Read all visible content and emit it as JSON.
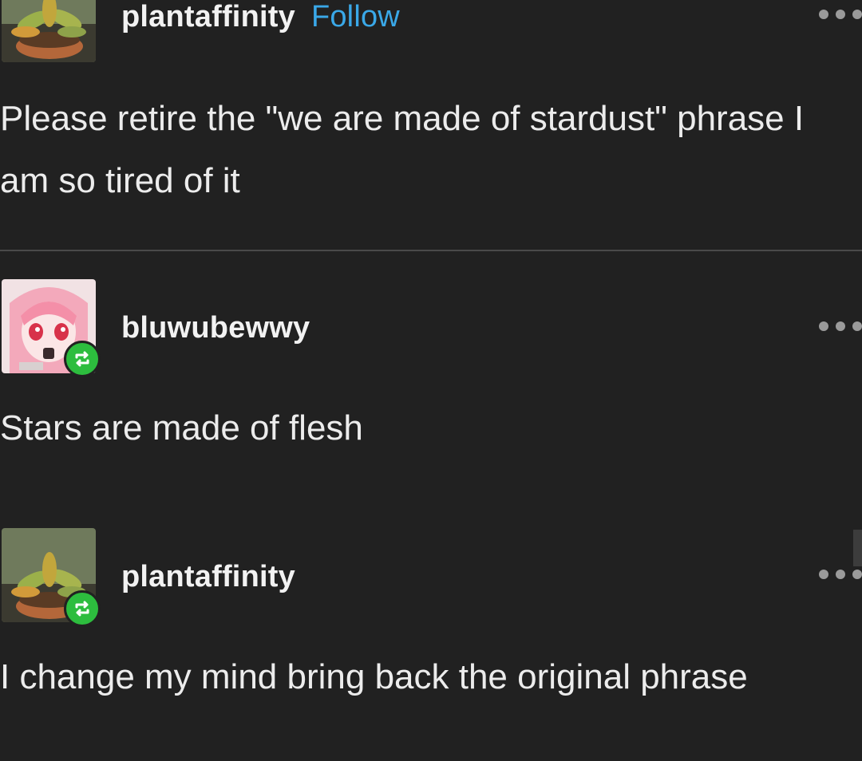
{
  "posts": [
    {
      "username": "plantaffinity",
      "follow_label": "Follow",
      "text": "Please retire the \"we are made of stardust\" phrase I am so tired of it",
      "avatar": "succulent-plant-avatar"
    },
    {
      "username": "bluwubewwy",
      "text": "Stars are made of flesh",
      "avatar": "anime-girl-avatar",
      "badge": "reblog-icon"
    },
    {
      "username": "plantaffinity",
      "text": "I change my mind bring back the original phrase",
      "avatar": "succulent-plant-avatar",
      "badge": "reblog-icon"
    }
  ],
  "colors": {
    "background": "#212121",
    "follow": "#3aa8e8",
    "reblog_badge": "#2dbd3e",
    "divider": "#4a4a4a"
  }
}
